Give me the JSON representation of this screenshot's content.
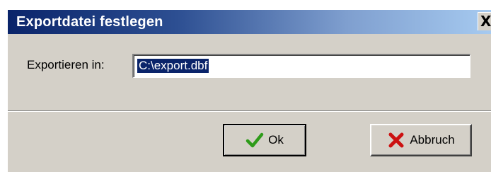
{
  "dialog": {
    "title": "Exportdatei festlegen",
    "close_glyph": "X"
  },
  "form": {
    "label": "Exportieren in:",
    "path_value": "C:\\export.dbf"
  },
  "buttons": {
    "ok_label": "Ok",
    "ok_icon": "checkmark-icon",
    "cancel_label": "Abbruch",
    "cancel_icon": "red-x-icon"
  },
  "colors": {
    "titlebar_start": "#0a246a",
    "titlebar_end": "#a6caf0",
    "dialog_face": "#d4d0c8",
    "selection": "#0a246a",
    "ok_icon": "#2e9b1a",
    "cancel_icon": "#cc1111"
  }
}
